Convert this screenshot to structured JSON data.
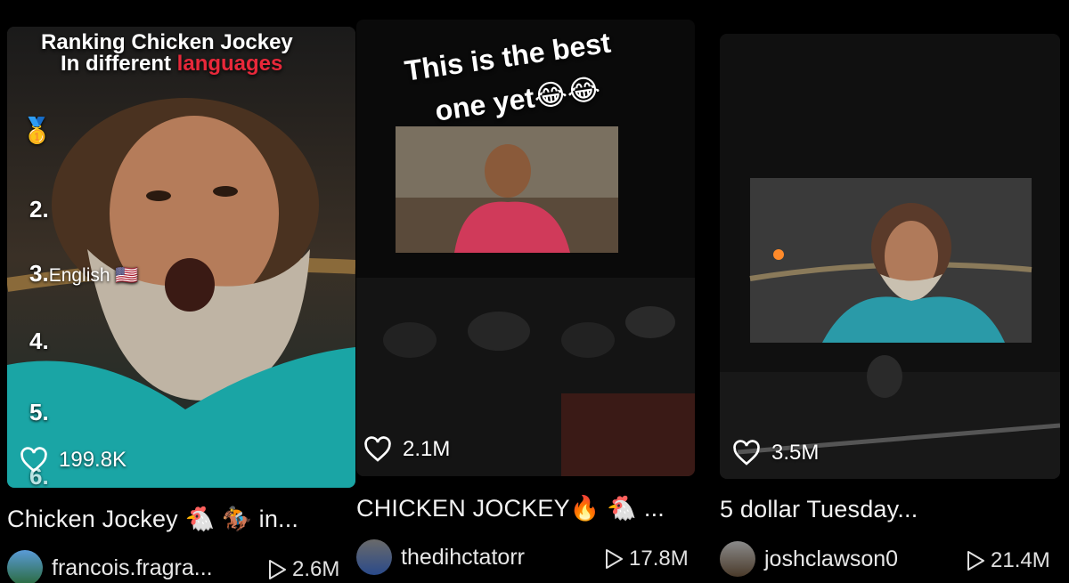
{
  "videos": [
    {
      "overlay_line1": "Ranking Chicken Jockey",
      "overlay_line2_a": "In different ",
      "overlay_line2_b": "languages",
      "ranks": [
        "2.",
        "3.",
        "English 🇺🇸",
        "4.",
        "5.",
        "6."
      ],
      "medal": "🥇",
      "likes": "199.8K",
      "caption": "Chicken Jockey 🐔 🏇 in...",
      "author": "francois.fragra...",
      "views": "2.6M"
    },
    {
      "overlay_line1": "This is the best",
      "overlay_line2": "one yet😂😂",
      "likes": "2.1M",
      "caption": "CHICKEN JOCKEY🔥 🐔 ...",
      "author": "thedihctatorr",
      "views": "17.8M"
    },
    {
      "likes": "3.5M",
      "caption": "5 dollar Tuesday...",
      "author": "joshclawson0",
      "views": "21.4M"
    }
  ],
  "colors": {
    "accent_red": "#e8283a",
    "background": "#000000"
  },
  "icons": {
    "like": "heart-icon",
    "play": "play-icon"
  }
}
